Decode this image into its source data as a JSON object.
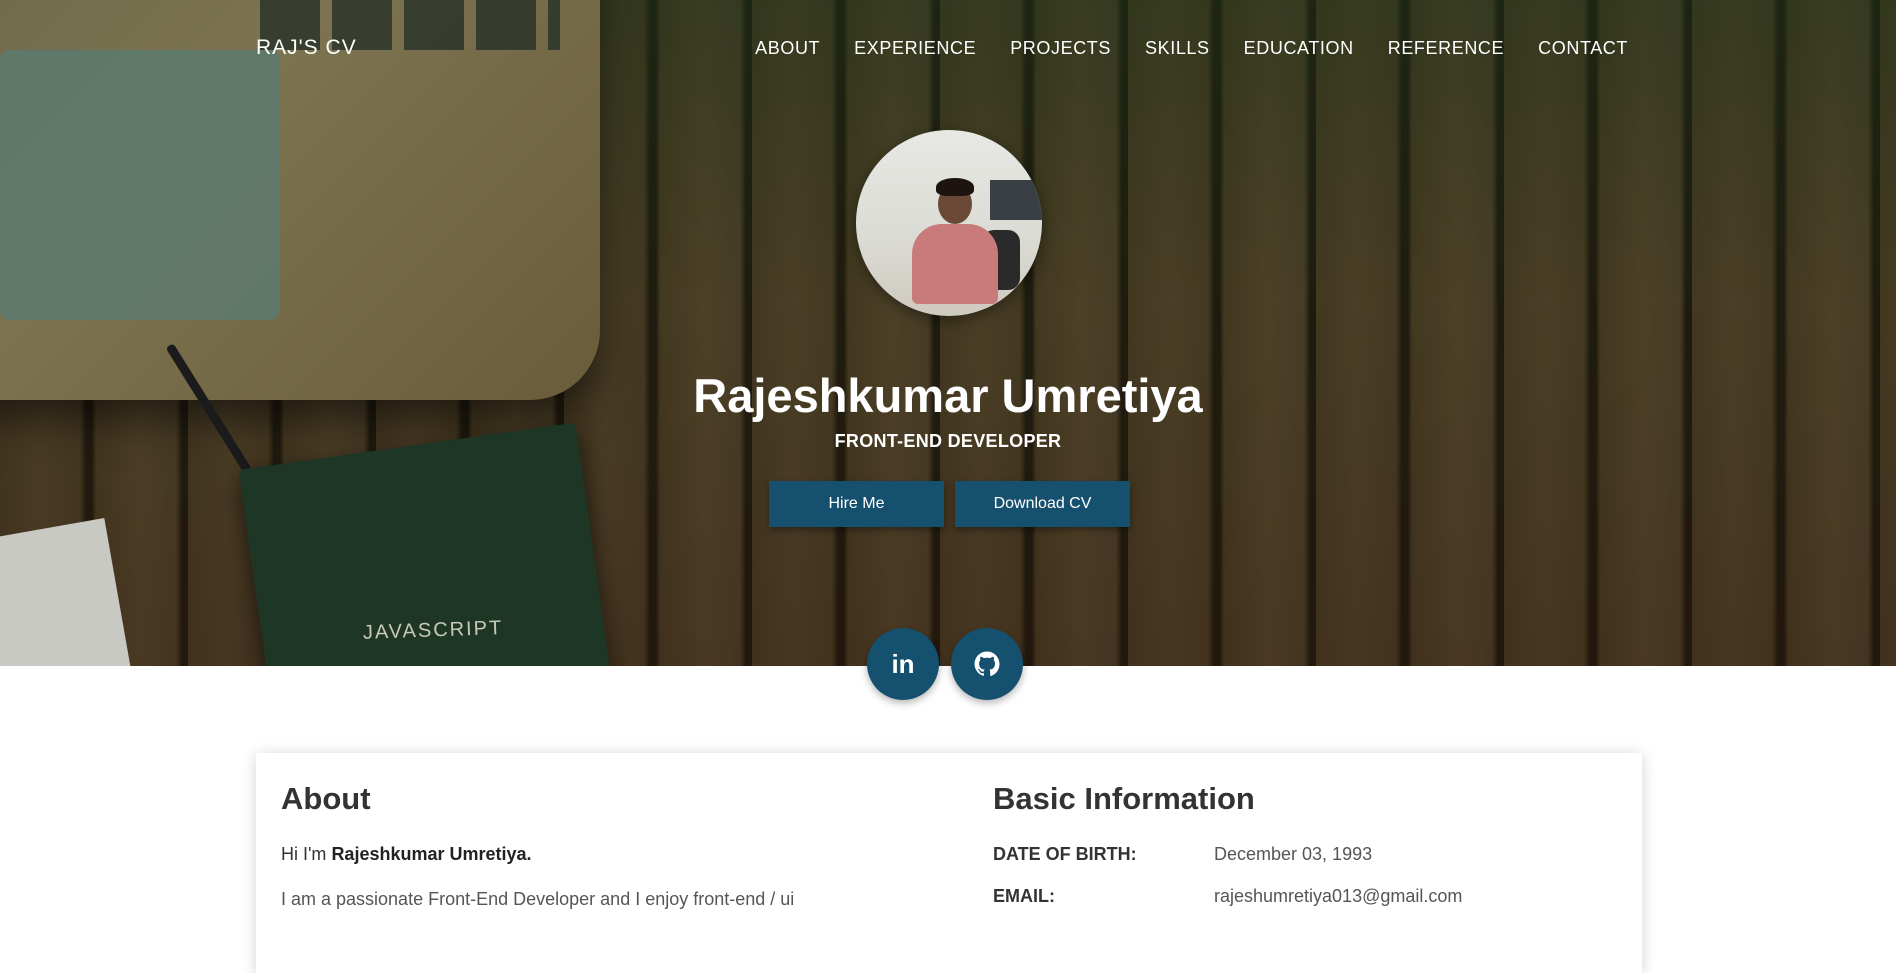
{
  "nav": {
    "brand": "RAJ'S CV",
    "items": [
      "ABOUT",
      "EXPERIENCE",
      "PROJECTS",
      "SKILLS",
      "EDUCATION",
      "REFERENCE",
      "CONTACT"
    ]
  },
  "hero": {
    "name": "Rajeshkumar Umretiya",
    "role": "FRONT-END DEVELOPER",
    "hire_label": "Hire Me",
    "download_label": "Download CV",
    "book_text": "JAVASCRIPT"
  },
  "social": {
    "items": [
      "linkedin-icon",
      "github-icon"
    ]
  },
  "about": {
    "heading": "About",
    "greeting": "Hi I'm ",
    "name_bold": "Rajeshkumar Umretiya.",
    "line2": "I am a passionate Front-End Developer and I enjoy front-end / ui"
  },
  "basic_info": {
    "heading": "Basic Information",
    "rows": [
      {
        "label": "DATE OF BIRTH:",
        "value": "December 03, 1993"
      },
      {
        "label": "EMAIL:",
        "value": "rajeshumretiya013@gmail.com"
      }
    ]
  },
  "colors": {
    "accent": "#15506f",
    "text_dark": "#333333"
  }
}
